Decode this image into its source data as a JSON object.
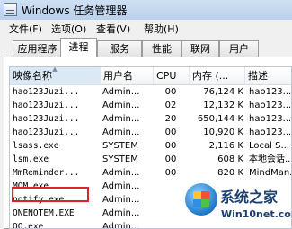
{
  "window": {
    "title": "Windows 任务管理器"
  },
  "menu": [
    "文件(F)",
    "选项(O)",
    "查看(V)",
    "帮助(H)"
  ],
  "tabs": [
    "应用程序",
    "进程",
    "服务",
    "性能",
    "联网",
    "用户"
  ],
  "active_tab": "进程",
  "columns": {
    "name": "映像名称",
    "user": "用户名",
    "cpu": "CPU",
    "mem": "内存 (...",
    "desc": "描述"
  },
  "processes": [
    {
      "name": "hao123Juzi...",
      "user": "Admin...",
      "cpu": "00",
      "mem": "76,124 K",
      "desc": "hao123..."
    },
    {
      "name": "hao123Juzi...",
      "user": "Admin...",
      "cpu": "02",
      "mem": "12,132 K",
      "desc": "hao123..."
    },
    {
      "name": "hao123Juzi...",
      "user": "Admin...",
      "cpu": "20",
      "mem": "650,144 K",
      "desc": "hao123..."
    },
    {
      "name": "hao123Juzi...",
      "user": "Admin...",
      "cpu": "00",
      "mem": "10,920 K",
      "desc": "hao123..."
    },
    {
      "name": "lsass.exe",
      "user": "SYSTEM",
      "cpu": "00",
      "mem": "2,116 K",
      "desc": "Local S..."
    },
    {
      "name": "lsm.exe",
      "user": "SYSTEM",
      "cpu": "00",
      "mem": "608 K",
      "desc": "本地会话..."
    },
    {
      "name": "MmReminder...",
      "user": "Admin...",
      "cpu": "00",
      "mem": "820 K",
      "desc": "MindMan..."
    },
    {
      "name": "MOM.exe",
      "user": "Admin...",
      "cpu": "",
      "mem": "",
      "desc": ""
    },
    {
      "name": "notify.exe",
      "user": "Admin...",
      "cpu": "",
      "mem": "",
      "desc": ""
    },
    {
      "name": "ONENOTEM.EXE",
      "user": "Admin...",
      "cpu": "",
      "mem": "",
      "desc": ""
    },
    {
      "name": "QQ.exe",
      "user": "Admin...",
      "cpu": "",
      "mem": "",
      "desc": ""
    }
  ],
  "highlighted_process": "notify.exe",
  "watermark": {
    "title": "系统之家",
    "url": "Win10net.com"
  },
  "colors": {
    "highlight_border": "#d8262b",
    "titlebar": "#c3d8ef"
  }
}
